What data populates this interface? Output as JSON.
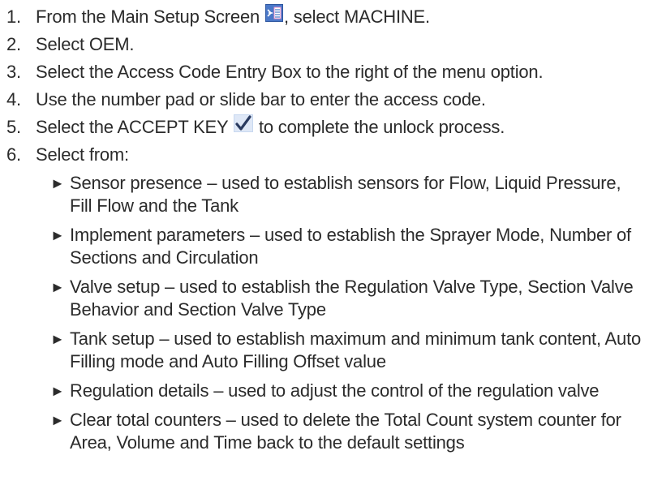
{
  "steps": [
    {
      "num": "1.",
      "before": "From the Main Setup Screen ",
      "icon": "main-setup-screen-icon",
      "after": ", select MACHINE."
    },
    {
      "num": "2.",
      "text": "Select OEM."
    },
    {
      "num": "3.",
      "text": "Select the Access Code Entry Box to the right of the menu option."
    },
    {
      "num": "4.",
      "text": "Use the number pad or slide bar to enter the access code."
    },
    {
      "num": "5.",
      "before": "Select the ACCEPT KEY ",
      "icon": "checkmark-icon",
      "after": " to complete the unlock process."
    },
    {
      "num": "6.",
      "text": "Select from:"
    }
  ],
  "bullet_marker": "►",
  "bullets": [
    "Sensor presence – used to establish sensors for Flow, Liquid Pressure, Fill Flow and the Tank",
    "Implement parameters – used to establish the Sprayer Mode, Number of Sections and Circulation",
    "Valve setup – used to establish the Regulation Valve Type, Section Valve Behavior and Section Valve Type",
    "Tank setup – used to establish maximum and minimum tank content, Auto Filling mode and Auto Filling Offset value",
    "Regulation details – used to adjust the control of the regulation valve",
    "Clear total counters – used to delete the Total Count system counter for Area, Volume and Time back to the default settings"
  ],
  "colors": {
    "text": "#2b2b2b",
    "icon_blue": "#4a78c8",
    "icon_pink": "#e890c8",
    "check_fill": "#c8d8f0"
  }
}
